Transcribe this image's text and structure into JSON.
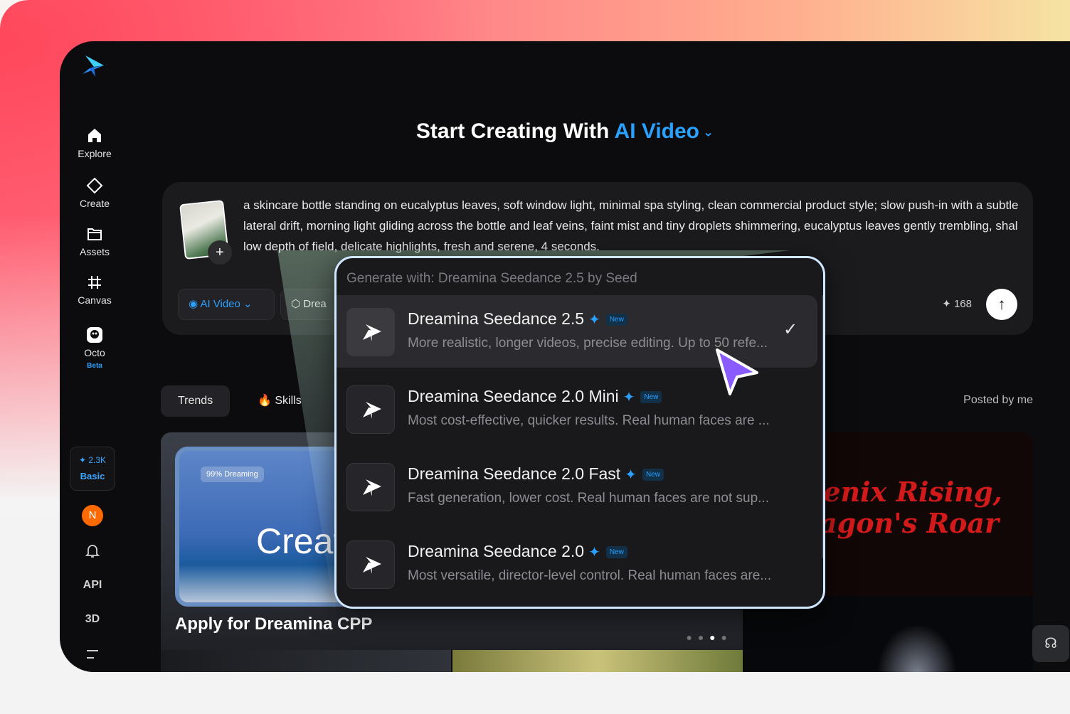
{
  "sidebar": {
    "items": [
      {
        "label": "Explore",
        "icon": "home-icon"
      },
      {
        "label": "Create",
        "icon": "diamond-icon"
      },
      {
        "label": "Assets",
        "icon": "folder-icon"
      },
      {
        "label": "Canvas",
        "icon": "frame-icon"
      },
      {
        "label": "Octo",
        "icon": "octo-icon",
        "badge": "Beta"
      }
    ],
    "credits": "2.3K",
    "plan": "Basic",
    "avatar_initial": "N",
    "api_label": "API",
    "three_d_label": "3D"
  },
  "heading": {
    "prefix": "Start Creating With",
    "accent": "AI Video"
  },
  "prompt": {
    "text": "a skincare bottle standing on eucalyptus leaves, soft window light, minimal spa styling, clean commercial product style; slow push-in with a subtle lateral drift, morning light gliding across the bottle and leaf veins, faint mist and tiny droplets shimmering, eucalyptus leaves gently trembling, shallow depth of field, delicate highlights, fresh and serene, 4 seconds.",
    "mode_label": "AI Video",
    "model_label": "Drea",
    "credit_cost": "168"
  },
  "tabs": [
    {
      "label": "Trends"
    },
    {
      "label": "Skills"
    }
  ],
  "posted_filter": "Posted by me",
  "banner": {
    "chip": "99% Dreaming",
    "big_text": "Creat",
    "title": "Apply for Dreamina CPP"
  },
  "poster": {
    "line1": "oenix Rising,",
    "line2": "ragon's Roar"
  },
  "dropdown": {
    "header": "Generate with: Dreamina Seedance 2.5 by Seed",
    "new_badge": "New",
    "items": [
      {
        "title": "Dreamina Seedance 2.5",
        "desc": "More realistic, longer videos, precise editing. Up to 50 refe...",
        "selected": true
      },
      {
        "title": "Dreamina Seedance 2.0 Mini",
        "desc": "Most cost-effective, quicker results. Real human faces are ...",
        "selected": false
      },
      {
        "title": "Dreamina Seedance 2.0 Fast",
        "desc": "Fast generation, lower cost. Real human faces are not sup...",
        "selected": false
      },
      {
        "title": "Dreamina Seedance 2.0",
        "desc": "Most versatile, director-level control. Real human faces are...",
        "selected": false
      }
    ]
  },
  "colors": {
    "accent": "#2aa0ff",
    "background": "#0c0c0e",
    "card": "#1b1b1e"
  }
}
